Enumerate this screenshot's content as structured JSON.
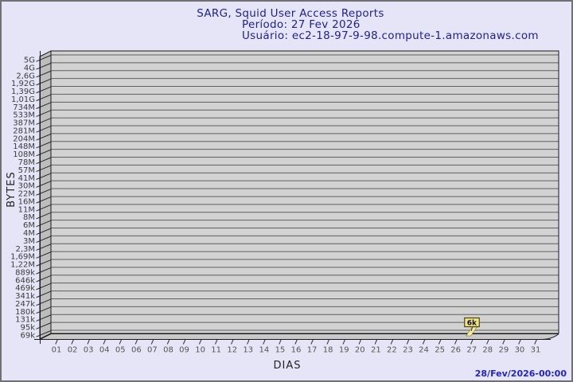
{
  "header": {
    "title": "SARG, Squid User Access Reports",
    "period": "Período: 27 Fev 2026",
    "user": "Usuário: ec2-18-97-9-98.compute-1.amazonaws.com"
  },
  "chart_data": {
    "type": "bar",
    "title": "SARG, Squid User Access Reports",
    "subtitle": "Período: 27 Fev 2026",
    "user": "Usuário: ec2-18-97-9-98.compute-1.amazonaws.com",
    "xlabel": "DIAS",
    "ylabel": "BYTES",
    "scale": "log",
    "grid": "horizontal",
    "legend_position": "none",
    "x_categories": [
      "01",
      "02",
      "03",
      "04",
      "05",
      "06",
      "07",
      "08",
      "09",
      "10",
      "11",
      "12",
      "13",
      "14",
      "15",
      "16",
      "17",
      "18",
      "19",
      "20",
      "21",
      "22",
      "23",
      "24",
      "25",
      "26",
      "27",
      "28",
      "29",
      "30",
      "31"
    ],
    "y_tick_labels_top_to_bottom": [
      "5G",
      "4G",
      "2,6G",
      "1,92G",
      "1,39G",
      "1,01G",
      "734M",
      "533M",
      "387M",
      "281M",
      "204M",
      "148M",
      "108M",
      "78M",
      "57M",
      "41M",
      "30M",
      "22M",
      "16M",
      "11M",
      "8M",
      "6M",
      "4M",
      "3M",
      "2,3M",
      "1,69M",
      "1,22M",
      "889k",
      "646k",
      "469k",
      "341k",
      "247k",
      "180k",
      "131k",
      "95k",
      "69k"
    ],
    "ylim_labels": [
      "69k",
      "5G"
    ],
    "points": [
      {
        "day": "27",
        "value_label": "6k",
        "value_bytes": 6000
      }
    ]
  },
  "footer": {
    "generated": "28/Fev/2026-00:00"
  },
  "colors": {
    "background": "#e5e5f7",
    "frame": "#6f6f74",
    "plot_face": "#d2d2d2",
    "wall": "#bdbdbd",
    "floor": "#c9c9c9",
    "grid": "#5f5f5f",
    "axis": "#1a1a1a",
    "title_text": "#1f1f8f",
    "y_tick_text": "#3d3d3d",
    "x_tick_text": "#555555",
    "timestamp_text": "#2424c0",
    "marker_fill": "#f0e58c",
    "marker_border": "#4d470f",
    "bar_fill": "#f6e9a0",
    "bar_border": "#7a6e1e"
  }
}
